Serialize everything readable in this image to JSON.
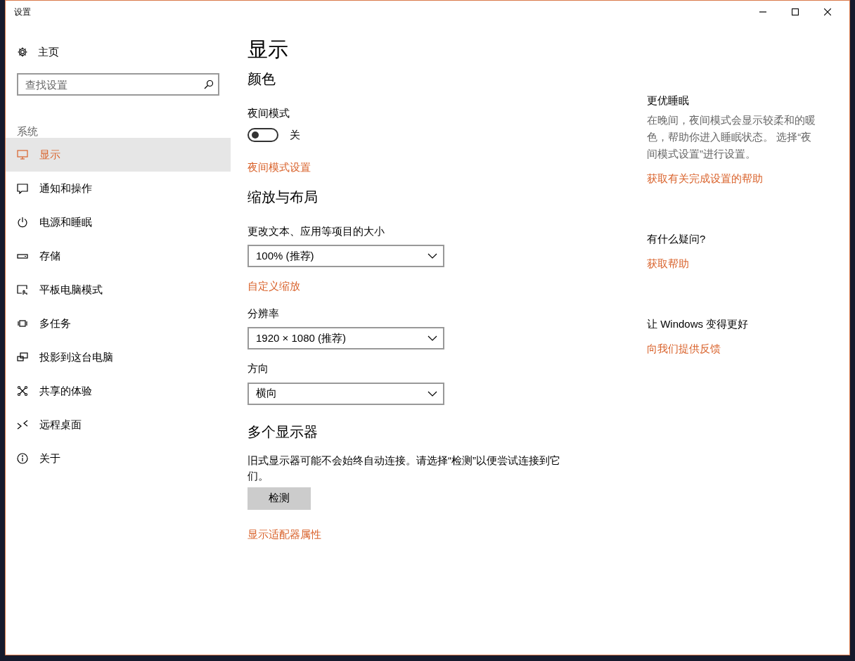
{
  "window": {
    "title": "设置"
  },
  "sidebar": {
    "home": "主页",
    "search": {
      "placeholder": "查找设置"
    },
    "section": "系统",
    "items": [
      {
        "label": "显示",
        "selected": true
      },
      {
        "label": "通知和操作",
        "selected": false
      },
      {
        "label": "电源和睡眠",
        "selected": false
      },
      {
        "label": "存储",
        "selected": false
      },
      {
        "label": "平板电脑模式",
        "selected": false
      },
      {
        "label": "多任务",
        "selected": false
      },
      {
        "label": "投影到这台电脑",
        "selected": false
      },
      {
        "label": "共享的体验",
        "selected": false
      },
      {
        "label": "远程桌面",
        "selected": false
      },
      {
        "label": "关于",
        "selected": false
      }
    ]
  },
  "main": {
    "title": "显示",
    "color": {
      "heading": "颜色",
      "night_light": {
        "label": "夜间模式",
        "on": false,
        "state_text": "关"
      },
      "link": "夜间模式设置"
    },
    "scale": {
      "heading": "缩放与布局",
      "size_label": "更改文本、应用等项目的大小",
      "size_value": "100% (推荐)",
      "custom_link": "自定义缩放",
      "resolution_label": "分辨率",
      "resolution_value": "1920 × 1080 (推荐)",
      "orientation_label": "方向",
      "orientation_value": "横向"
    },
    "multi": {
      "heading": "多个显示器",
      "text": "旧式显示器可能不会始终自动连接。请选择“检测”以便尝试连接到它们。",
      "button": "检测",
      "link": "显示适配器属性"
    }
  },
  "aside": [
    {
      "heading": "更优睡眠",
      "text": "在晚间，夜间模式会显示较柔和的暖色，帮助你进入睡眠状态。 选择“夜间模式设置”进行设置。",
      "link": "获取有关完成设置的帮助"
    },
    {
      "heading": "有什么疑问?",
      "link": "获取帮助"
    },
    {
      "heading": "让 Windows 变得更好",
      "link": "向我们提供反馈"
    }
  ]
}
